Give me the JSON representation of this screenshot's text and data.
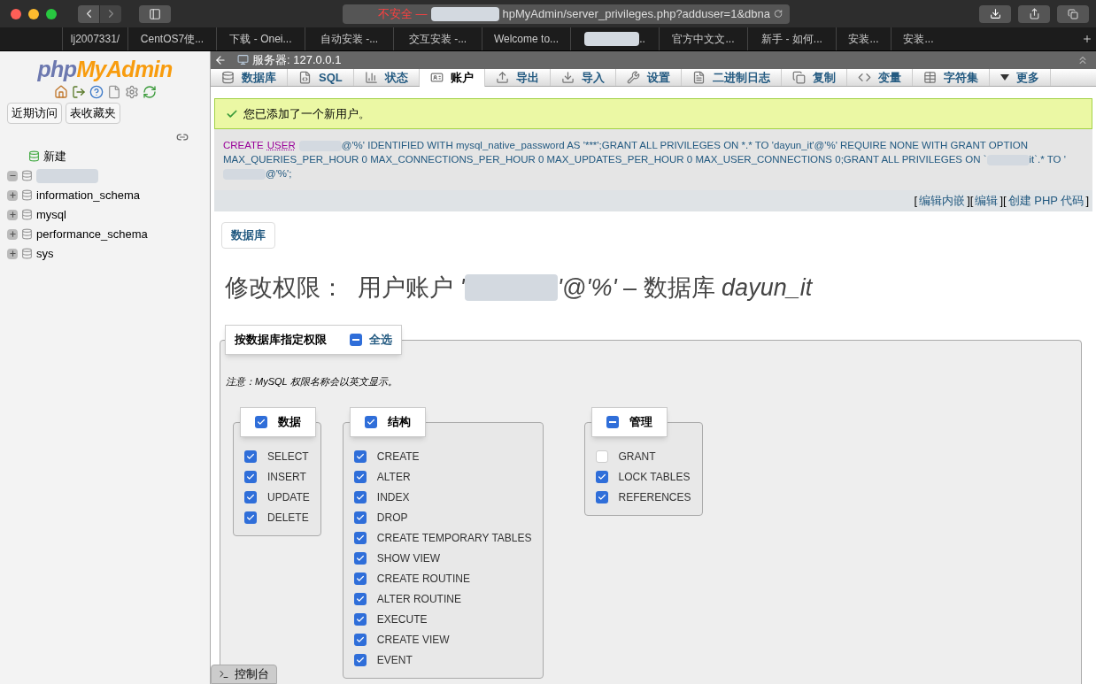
{
  "browser": {
    "url_warning": "不安全 —",
    "url": "hpMyAdmin/server_privileges.php?adduser=1&dbna",
    "tabs": [
      {
        "title": "lj2007331/",
        "redacted": false
      },
      {
        "title": "CentOS7使...",
        "redacted": false
      },
      {
        "title": "下载 - Onei...",
        "redacted": false
      },
      {
        "title": "自动安装 -...",
        "redacted": false
      },
      {
        "title": "交互安装 -...",
        "redacted": false
      },
      {
        "title": "Welcome to...",
        "redacted": false
      },
      {
        "title": "..",
        "redacted": true
      },
      {
        "title": "官方中文文...",
        "redacted": false
      },
      {
        "title": "新手 - 如何...",
        "redacted": false
      },
      {
        "title": "安装...",
        "redacted": false
      },
      {
        "title": "安装...",
        "redacted": false
      }
    ]
  },
  "sidebar": {
    "logo_php": "php",
    "logo_rest": "MyAdmin",
    "quick_buttons": [
      "近期访问",
      "表收藏夹"
    ],
    "tree": [
      {
        "kind": "new",
        "name": "新建"
      },
      {
        "kind": "redacted",
        "expanded": true
      },
      {
        "kind": "database",
        "name": "information_schema",
        "expanded": false
      },
      {
        "kind": "database",
        "name": "mysql",
        "expanded": false
      },
      {
        "kind": "database",
        "name": "performance_schema",
        "expanded": false
      },
      {
        "kind": "database",
        "name": "sys",
        "expanded": false
      }
    ]
  },
  "server_bar": {
    "title": "服务器: 127.0.0.1"
  },
  "tabs": [
    {
      "label": "数据库",
      "selected": false
    },
    {
      "label": "SQL",
      "selected": false
    },
    {
      "label": "状态",
      "selected": false
    },
    {
      "label": "账户",
      "selected": true
    },
    {
      "label": "导出",
      "selected": false
    },
    {
      "label": "导入",
      "selected": false
    },
    {
      "label": "设置",
      "selected": false
    },
    {
      "label": "二进制日志",
      "selected": false
    },
    {
      "label": "复制",
      "selected": false
    },
    {
      "label": "变量",
      "selected": false
    },
    {
      "label": "字符集",
      "selected": false
    },
    {
      "label": "更多",
      "selected": false
    }
  ],
  "success_message": "您已添加了一个新用户。",
  "sql": [
    {
      "kind": "keyword",
      "text": "CREATE"
    },
    {
      "kind": "link",
      "text": "USER"
    },
    {
      "kind": "redacted"
    },
    {
      "kind": "text",
      "text": "@'%' IDENTIFIED WITH mysql_native_password AS '***';GRANT ALL PRIVILEGES ON *.* TO 'dayun_it'@'%' REQUIRE NONE WITH GRANT OPTION MAX_QUERIES_PER_HOUR 0 MAX_CONNECTIONS_PER_HOUR 0 MAX_UPDATES_PER_HOUR 0 MAX_USER_CONNECTIONS 0;GRANT ALL PRIVILEGES ON `"
    },
    {
      "kind": "redacted"
    },
    {
      "kind": "text",
      "text": "it`.* TO '"
    },
    {
      "kind": "redacted"
    },
    {
      "kind": "text",
      "text": "@'%';"
    }
  ],
  "sql_links": [
    {
      "open": "[",
      "label": "编辑内嵌",
      "close": "]"
    },
    {
      "open": "[",
      "label": "编辑",
      "close": "]"
    },
    {
      "open": "[",
      "label": "创建 PHP 代码",
      "close": "]"
    }
  ],
  "database_button": "数据库",
  "heading": {
    "prefix": "修改权限：  用户账户 *'*",
    "suffix": "*'@'%'* – 数据库 *dayun_it*"
  },
  "fieldset": {
    "legend": "按数据库指定权限",
    "select_all": "全选",
    "select_all_checked": true,
    "select_all_mixed": true,
    "note": "注意：MySQL 权限名称会以英文显示。",
    "groups": [
      {
        "title": "数据",
        "checked": true,
        "mixed": false,
        "items": [
          {
            "label": "SELECT",
            "checked": true
          },
          {
            "label": "INSERT",
            "checked": true
          },
          {
            "label": "UPDATE",
            "checked": true
          },
          {
            "label": "DELETE",
            "checked": true
          }
        ]
      },
      {
        "title": "结构",
        "checked": true,
        "mixed": false,
        "items": [
          {
            "label": "CREATE",
            "checked": true
          },
          {
            "label": "ALTER",
            "checked": true
          },
          {
            "label": "INDEX",
            "checked": true
          },
          {
            "label": "DROP",
            "checked": true
          },
          {
            "label": "CREATE TEMPORARY TABLES",
            "checked": true
          },
          {
            "label": "SHOW VIEW",
            "checked": true
          },
          {
            "label": "CREATE ROUTINE",
            "checked": true
          },
          {
            "label": "ALTER ROUTINE",
            "checked": true
          },
          {
            "label": "EXECUTE",
            "checked": true
          },
          {
            "label": "CREATE VIEW",
            "checked": true
          },
          {
            "label": "EVENT",
            "checked": true
          }
        ]
      },
      {
        "title": "管理",
        "checked": true,
        "mixed": true,
        "items": [
          {
            "label": "GRANT",
            "checked": false
          },
          {
            "label": "LOCK TABLES",
            "checked": true
          },
          {
            "label": "REFERENCES",
            "checked": true
          }
        ]
      }
    ]
  },
  "console": "控制台"
}
